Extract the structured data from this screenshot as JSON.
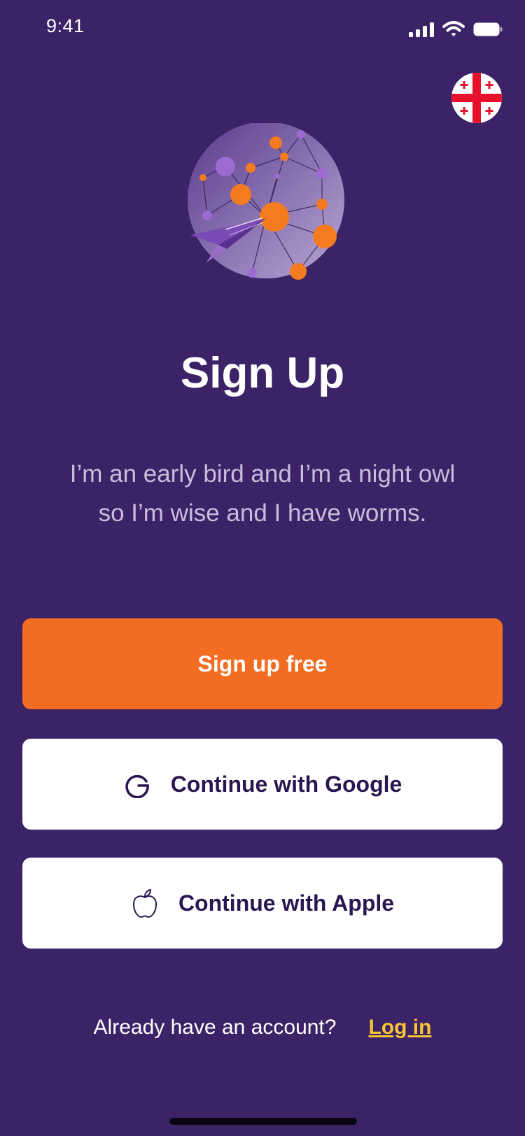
{
  "status_bar": {
    "time": "9:41",
    "icons": [
      "cellular-signal-icon",
      "wifi-icon",
      "battery-icon"
    ]
  },
  "language_selector": {
    "icon": "georgia-flag-icon"
  },
  "hero": {
    "icon": "network-globe-paper-plane-illustration"
  },
  "title": "Sign Up",
  "subtitle": "I’m an early bird and I’m a night owl so I’m wise and I have worms.",
  "buttons": {
    "signup": "Sign up free",
    "google": "Continue with Google",
    "apple": "Continue with Apple"
  },
  "footer": {
    "prompt": "Already have an account?",
    "login": "Log in"
  },
  "colors": {
    "background": "#3c2266",
    "primary": "#f26d21",
    "accent_link": "#f7c531",
    "button_text_dark": "#2a1650",
    "subtitle": "#c8bddb"
  }
}
